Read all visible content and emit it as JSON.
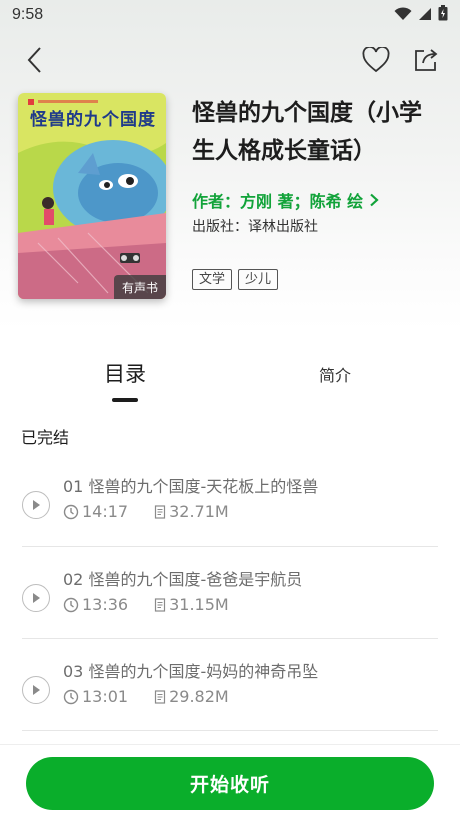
{
  "status_bar": {
    "time": "9:58"
  },
  "book": {
    "title": "怪兽的九个国度（小学生人格成长童话）",
    "author": "作者：方刚 著；陈希 绘",
    "publisher_label": "出版社：",
    "publisher": "译林出版社",
    "tags": [
      "文学",
      "少儿"
    ],
    "cover": {
      "title": "怪兽的九个国度",
      "badge": "有声书"
    }
  },
  "tabs": [
    {
      "label": "目录",
      "active": true
    },
    {
      "label": "简介",
      "active": false
    }
  ],
  "catalog": {
    "status": "已完结",
    "chapters": [
      {
        "title": "01 怪兽的九个国度-天花板上的怪兽",
        "duration": "14:17",
        "size": "32.71M"
      },
      {
        "title": "02 怪兽的九个国度-爸爸是宇航员",
        "duration": "13:36",
        "size": "31.15M"
      },
      {
        "title": "03 怪兽的九个国度-妈妈的神奇吊坠",
        "duration": "13:01",
        "size": "29.82M"
      }
    ]
  },
  "actions": {
    "start_listening": "开始收听"
  },
  "colors": {
    "accent_green": "#0aae2b",
    "author_green": "#12a33a"
  },
  "icons": [
    "back-icon",
    "heart-icon",
    "share-icon",
    "play-icon",
    "clock-icon",
    "file-icon",
    "chevron-right-icon",
    "wifi-icon",
    "signal-icon",
    "battery-icon"
  ]
}
